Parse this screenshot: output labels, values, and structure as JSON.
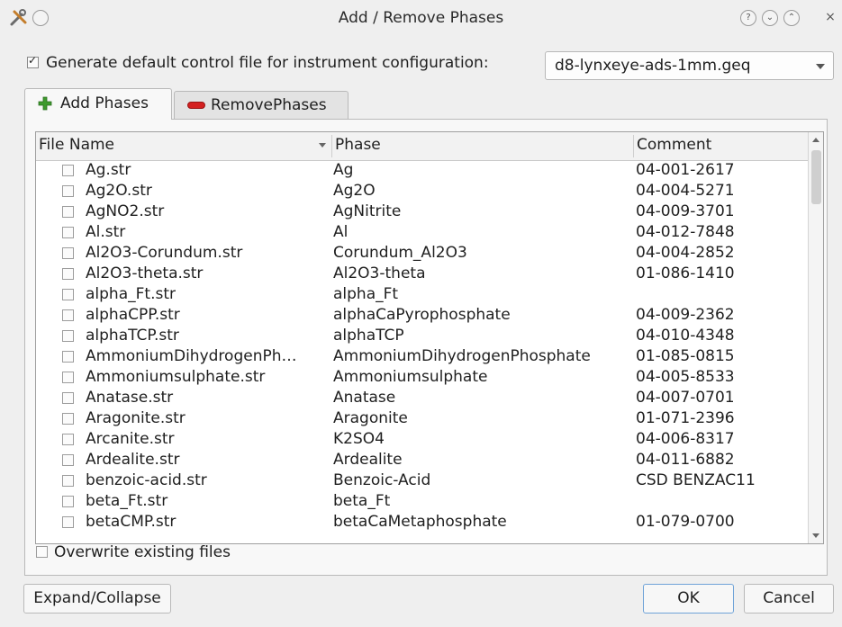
{
  "window": {
    "title": "Add / Remove Phases",
    "title_buttons": [
      "?",
      "⌄",
      "⌃",
      "×"
    ]
  },
  "generate": {
    "checked": true,
    "label": "Generate default control file for instrument configuration:",
    "config_value": "d8-lynxeye-ads-1mm.geq"
  },
  "tabs": [
    {
      "label": "Add Phases",
      "icon": "plus-icon",
      "active": true
    },
    {
      "label": "RemovePhases",
      "icon": "minus-icon",
      "active": false
    }
  ],
  "table": {
    "columns": [
      "File Name",
      "Phase",
      "Comment"
    ],
    "rows": [
      {
        "file": "Ag.str",
        "phase": "Ag",
        "comment": "04-001-2617"
      },
      {
        "file": "Ag2O.str",
        "phase": "Ag2O",
        "comment": "04-004-5271"
      },
      {
        "file": "AgNO2.str",
        "phase": "AgNitrite",
        "comment": "04-009-3701"
      },
      {
        "file": "Al.str",
        "phase": "Al",
        "comment": "04-012-7848"
      },
      {
        "file": "Al2O3-Corundum.str",
        "phase": "Corundum_Al2O3",
        "comment": "04-004-2852"
      },
      {
        "file": "Al2O3-theta.str",
        "phase": "Al2O3-theta",
        "comment": "01-086-1410"
      },
      {
        "file": "alpha_Ft.str",
        "phase": "alpha_Ft",
        "comment": ""
      },
      {
        "file": "alphaCPP.str",
        "phase": "alphaCaPyrophosphate",
        "comment": "04-009-2362"
      },
      {
        "file": "alphaTCP.str",
        "phase": "alphaTCP",
        "comment": "04-010-4348"
      },
      {
        "file": "AmmoniumDihydrogenPh…",
        "phase": "AmmoniumDihydrogenPhosphate",
        "comment": "01-085-0815"
      },
      {
        "file": "Ammoniumsulphate.str",
        "phase": "Ammoniumsulphate",
        "comment": "04-005-8533"
      },
      {
        "file": "Anatase.str",
        "phase": "Anatase",
        "comment": "04-007-0701"
      },
      {
        "file": "Aragonite.str",
        "phase": "Aragonite",
        "comment": "01-071-2396"
      },
      {
        "file": "Arcanite.str",
        "phase": "K2SO4",
        "comment": "04-006-8317"
      },
      {
        "file": "Ardealite.str",
        "phase": "Ardealite",
        "comment": "04-011-6882"
      },
      {
        "file": "benzoic-acid.str",
        "phase": "Benzoic-Acid",
        "comment": "CSD BENZAC11"
      },
      {
        "file": "beta_Ft.str",
        "phase": "beta_Ft",
        "comment": ""
      },
      {
        "file": "betaCMP.str",
        "phase": "betaCaMetaphosphate",
        "comment": "01-079-0700"
      }
    ]
  },
  "overwrite": {
    "checked": false,
    "label": "Overwrite existing files"
  },
  "buttons": {
    "expand": "Expand/Collapse",
    "ok": "OK",
    "cancel": "Cancel"
  },
  "colors": {
    "plus_icon": "#3e9a2e",
    "minus_icon": "#d42020",
    "ok_border": "#6fa3d8"
  }
}
